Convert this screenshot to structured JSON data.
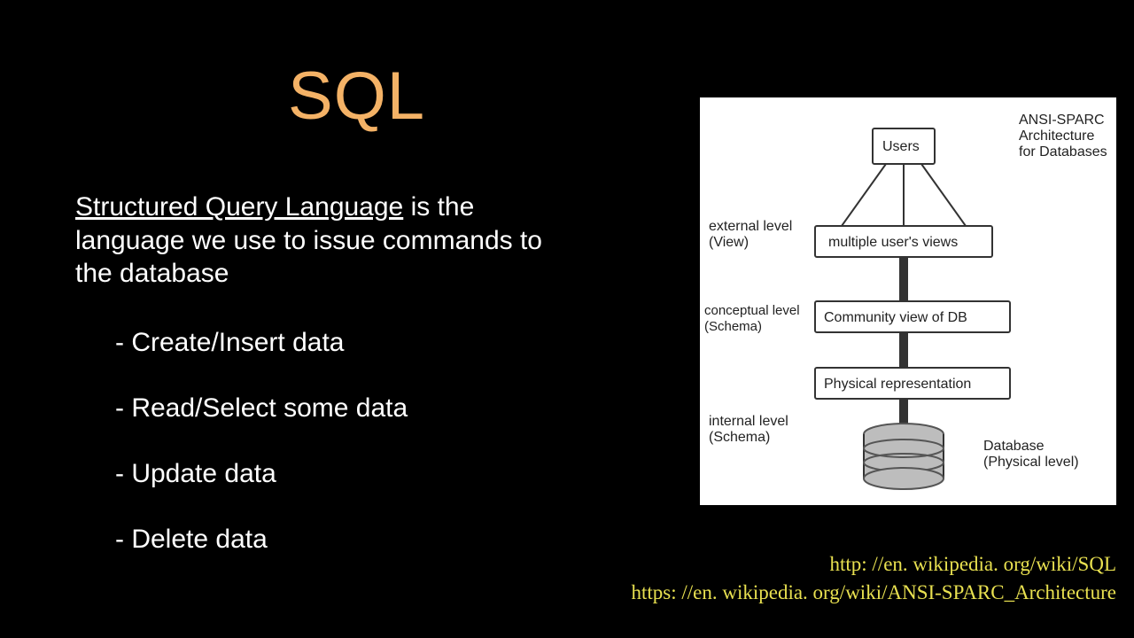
{
  "title": "SQL",
  "body": {
    "underlined": "Structured Query Language",
    "rest": " is the language we use to issue commands to the database"
  },
  "bullets": [
    "Create/Insert data",
    "Read/Select some data",
    "Update data",
    "Delete data"
  ],
  "links": [
    "http: //en. wikipedia. org/wiki/SQL",
    "https: //en. wikipedia. org/wiki/ANSI-SPARC_Architecture"
  ],
  "diagram": {
    "title": "ANSI-SPARC Architecture for Databases",
    "users": "Users",
    "external": "external level (View)",
    "views": "multiple user's views",
    "conceptual": "conceptual level (Schema)",
    "community": "Community view of DB",
    "physical_rep": "Physical representation",
    "internal": "internal level (Schema)",
    "db": "Database (Physical level)"
  }
}
